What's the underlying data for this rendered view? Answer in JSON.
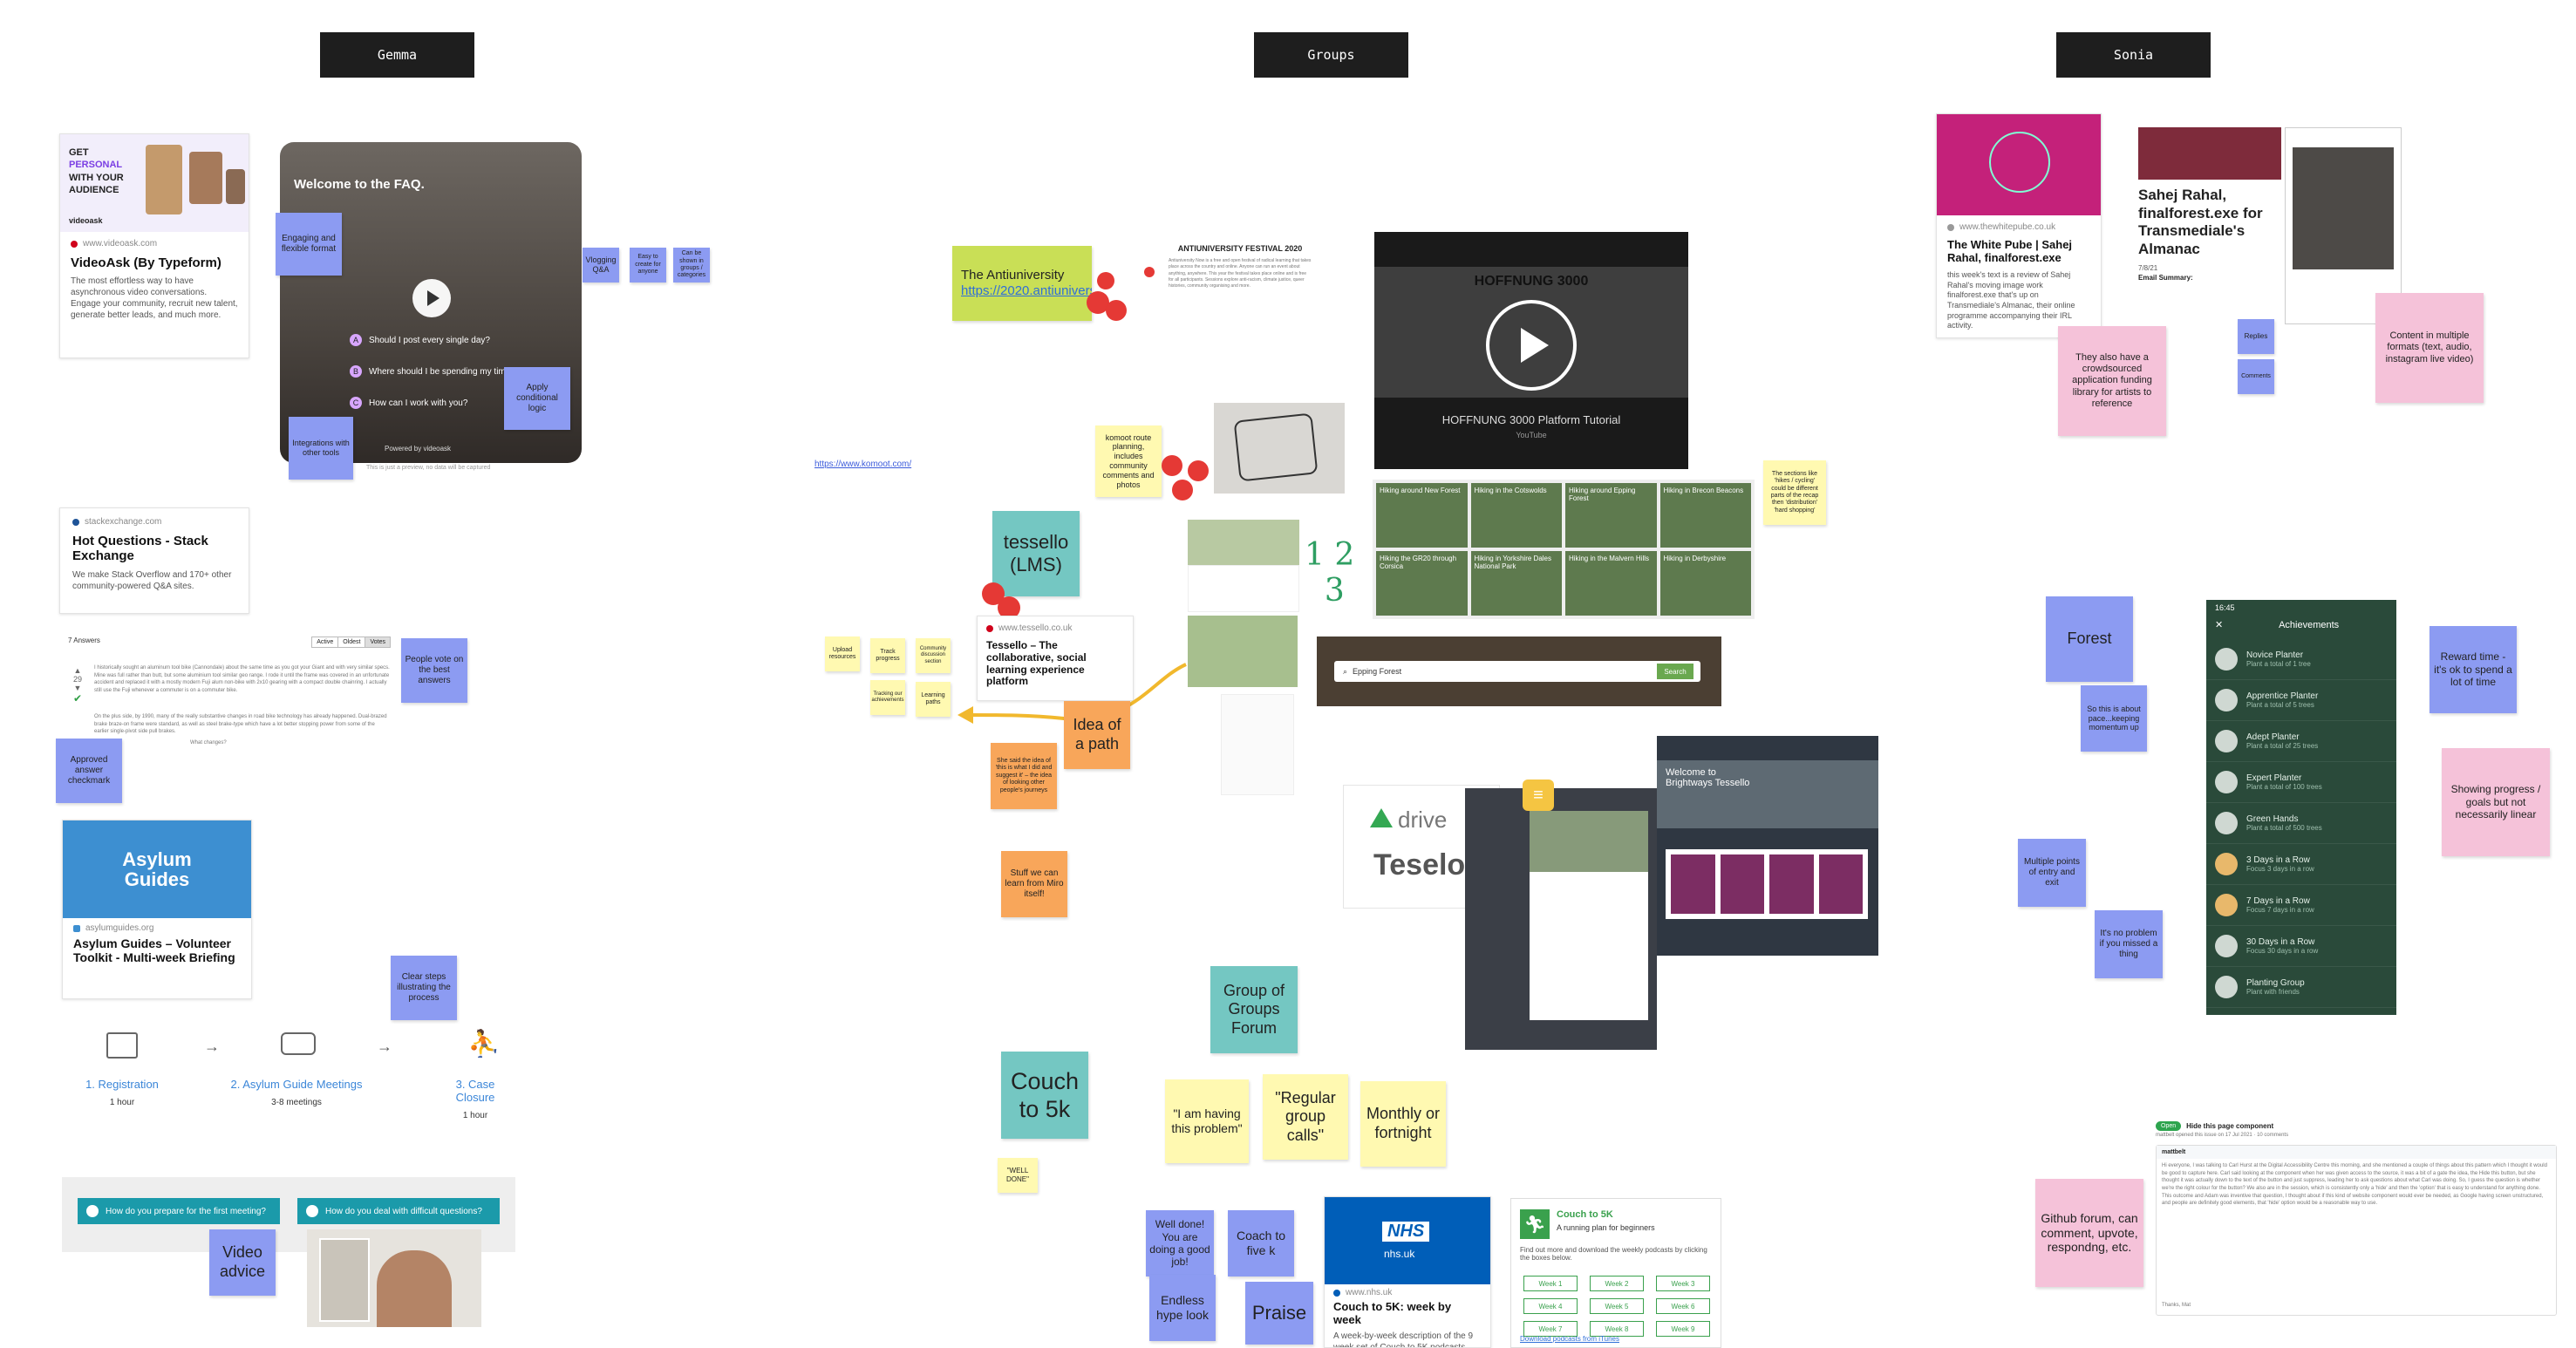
{
  "columns": {
    "gemma": "Gemma",
    "groups": "Groups",
    "sonia": "Sonia"
  },
  "gemma": {
    "videoask_card": {
      "banner_lines": [
        "GET",
        "PERSONAL",
        "WITH YOUR",
        "AUDIENCE"
      ],
      "logo": "videoask",
      "source": "www.videoask.com",
      "title": "VideoAsk (By Typeform)",
      "description": "The most effortless way to have asynchronous video conversations. Engage your community, recruit new talent, generate better leads, and much more."
    },
    "video": {
      "heading": "Welcome to the FAQ.",
      "questions": [
        {
          "num": "A",
          "text": "Should I post every single day?"
        },
        {
          "num": "B",
          "text": "Where should I be spending my time?"
        },
        {
          "num": "C",
          "text": "How can I work with you?"
        }
      ],
      "powered_by": "Powered by videoask",
      "caption": "This is just a preview, no data will be captured"
    },
    "stickies": {
      "engaging": "Engaging and flexible format",
      "conditional": "Apply conditional logic",
      "integrations": "Integrations with other tools",
      "vlogging": "Vlogging Q&A",
      "easy_people": "Easy to create for anyone",
      "categories": "Can be shown in groups / categories",
      "people_vote": "People vote on the best answers",
      "approved": "Approved answer checkmark",
      "clear_steps": "Clear steps illustrating the process",
      "video_advice": "Video advice"
    },
    "stack_card": {
      "source": "stackexchange.com",
      "title": "Hot Questions - Stack Exchange",
      "description": "We make Stack Overflow and 170+ other community-powered Q&A sites."
    },
    "answers": {
      "count": "7 Answers",
      "sort_tabs": [
        "Active",
        "Oldest",
        "Votes"
      ],
      "vote_score": "29",
      "answer_text": "I historically sought an aluminum tool bike (Cannondale) about the same time as you got your Giant and with very similar specs. Mine was full rather than butt, but some aluminium tool similar geo range. I rode it until the frame was covered in an unfortunate accident and replaced it with a mostly modern Fuji alum non-bike with 2x10 gearing with a compact double chainring. I actually still use the Fuji whenever a commuter is on a commuter bike.",
      "answer_text_2": "On the plus side, by 1990, many of the really substantive changes in road bike technology has already happened. Dual-brazed brake braze-on frame were standard, as well as steel brake-type which have a lot better stopping power from some of the earlier single-pivot side pull brakes.",
      "changes": "What changes?"
    },
    "asylum_card": {
      "banner": "Asylum Guides",
      "source": "asylumguides.org",
      "title": "Asylum Guides – Volunteer Toolkit - Multi-week Briefing"
    },
    "steps": [
      {
        "label": "1. Registration",
        "duration": "1 hour"
      },
      {
        "label": "2. Asylum Guide Meetings",
        "duration": "3-8 meetings"
      },
      {
        "label": "3. Case Closure",
        "duration": "1 hour"
      }
    ],
    "prep_buttons": [
      "How do you prepare for the first meeting?",
      "How do you deal with difficult questions?"
    ]
  },
  "groups": {
    "link_kumu": "https://www.komoot.com/",
    "antiuniversity": {
      "label": "The Antiuniversity",
      "link": "https://2020.antiuniversity.org/"
    },
    "festival_doc": {
      "title": "ANTIUNIVERSITY FESTIVAL 2020",
      "body": "Antiuniversity Now is a free and open festival of radical learning that takes place across the country and online. Anyone can run an event about anything, anywhere. This year the festival takes place online and is free for all participants. Sessions explore anti-racism, climate justice, queer histories, community organising and more."
    },
    "komoot_note": "komoot route planning, includes community comments and photos",
    "tessello_lms": "tessello (LMS)",
    "tessello_card": {
      "source": "www.tessello.co.uk",
      "title": "Tessello – The collaborative, social learning experience platform"
    },
    "small_notes": [
      "Upload resources",
      "Track progress",
      "Community discussion section",
      "Tracking our achievements",
      "Learning paths"
    ],
    "idea_of_path": "Idea of a path",
    "she_said": "She said the idea of 'this is what I did and suggest it' – the idea of looking other people's journeys",
    "stuff_miro": "Stuff we can learn from Miro itself!",
    "hoffnung": {
      "title": "HOFFNUNG 3000",
      "subtitle": "HOFFNUNG 3000 Platform Tutorial",
      "youtube": "YouTube"
    },
    "hikes": [
      "Hiking around New Forest",
      "Hiking in the Cotswolds",
      "Hiking around Epping Forest",
      "Hiking in Brecon Beacons",
      "Hiking the GR20 through Corsica",
      "Hiking in Yorkshire Dales National Park",
      "Hiking in the Malvern Hills",
      "Hiking in Derbyshire"
    ],
    "sections_note": "The sections like 'hikes / cycling' could be different parts of the recap then 'distribution' 'hard shopping'",
    "search_bar": {
      "query": "Epping Forest",
      "button": "Search"
    },
    "drive_logo": "drive",
    "teselo_text": "Teselo",
    "welcome_bright": "Welcome to Brightways Tessello",
    "group_forum": "Group of Groups Forum",
    "couch_5k": "Couch to 5k",
    "well_done_quote": "\"WELL DONE\"",
    "quotes": [
      "\"I am having this problem\"",
      "\"Regular group calls\"",
      "Monthly or fortnight"
    ],
    "praise_notes": {
      "well_done": "Well done! You are doing a good job!",
      "coach": "Coach to five k",
      "endless": "Endless hype look",
      "praise": "Praise"
    },
    "nhs_card": {
      "logo": "NHS",
      "url": "nhs.uk",
      "source": "www.nhs.uk",
      "title": "Couch to 5K: week by week",
      "description": "A week-by-week description of the 9 week set of Couch to 5K podcasts"
    },
    "c25k_card": {
      "title": "Couch to 5K",
      "subtitle": "A running plan for beginners",
      "body": "Find out more and download the weekly podcasts by clicking the boxes below.",
      "weeks": [
        "Week 1",
        "Week 2",
        "Week 3",
        "Week 4",
        "Week 5",
        "Week 6",
        "Week 7",
        "Week 8",
        "Week 9"
      ],
      "footer": "Download podcasts from iTunes"
    }
  },
  "sonia": {
    "white_pube": {
      "source": "www.thewhitepube.co.uk",
      "title": "The White Pube | Sahej Rahal, finalforest.exe",
      "description": "this week's text is a review of Sahej Rahal's moving image work finalforest.exe that's up on Transmediale's Almanac, their online programme accompanying their IRL activity."
    },
    "almanac_title": "Sahej Rahal, finalforest.exe for Transmediale's Almanac",
    "almanac_meta": "7/8/21",
    "almanac_summary": "Email Summary:",
    "stickies": {
      "crowdsourced": "They also have a crowdsourced application funding library for artists to reference",
      "replies": "Replies",
      "comments": "Comments",
      "multiple_formats": "Content in multiple formats (text, audio, instagram live video)",
      "forest": "Forest",
      "pace": "So this is about pace...keeping momentum up",
      "reward": "Reward time - it's ok to spend a lot of time",
      "progress": "Showing progress / goals but not necessarily linear",
      "entry_exit": "Multiple points of entry and exit",
      "no_problem": "It's no problem if you missed a thing",
      "github": "Github forum, can comment, upvote, respondng, etc."
    },
    "phone": {
      "time": "16:45",
      "header": "Achievements",
      "items": [
        {
          "name": "Novice Planter",
          "sub": "Plant a total of 1 tree"
        },
        {
          "name": "Apprentice Planter",
          "sub": "Plant a total of 5 trees"
        },
        {
          "name": "Adept Planter",
          "sub": "Plant a total of 25 trees"
        },
        {
          "name": "Expert Planter",
          "sub": "Plant a total of 100 trees"
        },
        {
          "name": "Green Hands",
          "sub": "Plant a total of 500 trees"
        },
        {
          "name": "3 Days in a Row",
          "sub": "Focus 3 days in a row"
        },
        {
          "name": "7 Days in a Row",
          "sub": "Focus 7 days in a row"
        },
        {
          "name": "30 Days in a Row",
          "sub": "Focus 30 days in a row"
        },
        {
          "name": "Planting Group",
          "sub": "Plant with friends"
        }
      ]
    },
    "github": {
      "badge": "Open",
      "title": "Hide this page component",
      "meta": "mattbelt opened this issue on 17 Jul 2021 · 10 comments",
      "author": "mattbelt",
      "body": "Hi everyone, I was talking to Carl Hurst at the Digital Accessibility Centre this morning, and she mentioned a couple of things about this pattern which I thought it would be good to capture here. Carl said looking at the component when her was given access to the source, it was a bit of a gate the idea, the Hide this button, but she thought it was actually down to the text of the button and just suppress, leading her to ask questions about what Carl was doing. So, I guess the question is whether we're the right colour for the button? We also are in the session, which is consistently only a 'hide' and then the 'option' that is easy to understand for anything done. This outcome and Adam was inventive that question, I thought about if this kind of website component would ever be needed, as Google having screen unstructured, and people are definitely good elements, that 'hide' option would be a reasonable way to use.",
      "thanks": "Thanks, Mat"
    }
  }
}
